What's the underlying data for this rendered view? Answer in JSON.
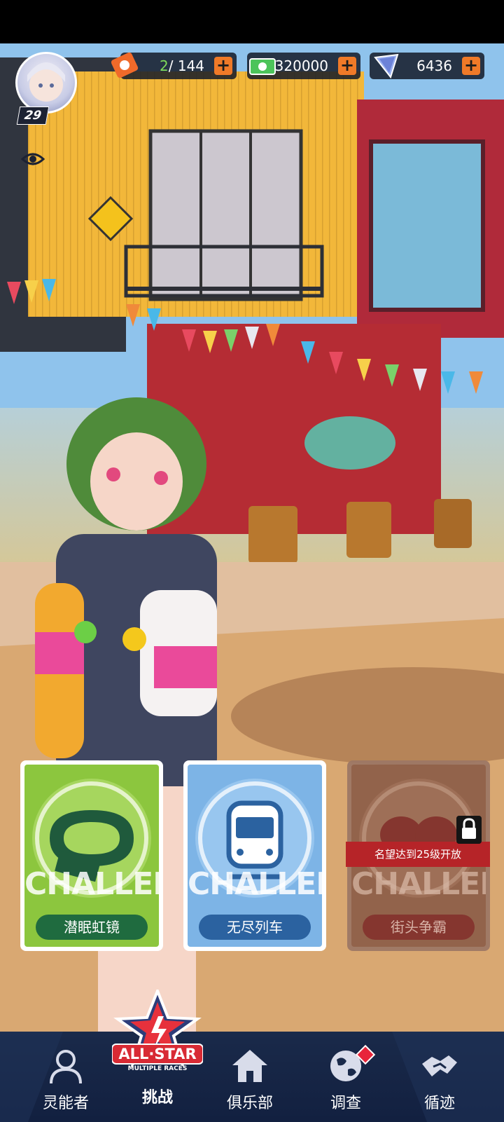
{
  "player": {
    "level": "29"
  },
  "resources": {
    "stamina": {
      "current": "2",
      "max": "/ 144",
      "plus": "+"
    },
    "cash": {
      "value": "320000",
      "plus": "+"
    },
    "gem": {
      "value": "6436",
      "plus": "+"
    }
  },
  "modes": [
    {
      "watermark": "CHALLENGE",
      "label": "潜眠虹镜"
    },
    {
      "watermark": "CHALLENGE",
      "label": "无尽列车"
    },
    {
      "watermark": "CHALLENGE",
      "label": "街头争霸",
      "locked_text": "名望达到25级开放"
    }
  ],
  "nav": {
    "psychic": "灵能者",
    "allstar_logo": "ALL·STAR",
    "allstar_sub": "MULTIPLE RACES",
    "challenge": "挑战",
    "club": "俱乐部",
    "survey": "调查",
    "trace": "循迹"
  },
  "colors": {
    "accent_orange": "#f07a28",
    "dream_green": "#8cc63e",
    "endless_blue": "#7db4e6",
    "locked_brown": "#8c5e48",
    "lock_red": "#b62428",
    "nav_bg": "#1a2a4a"
  }
}
